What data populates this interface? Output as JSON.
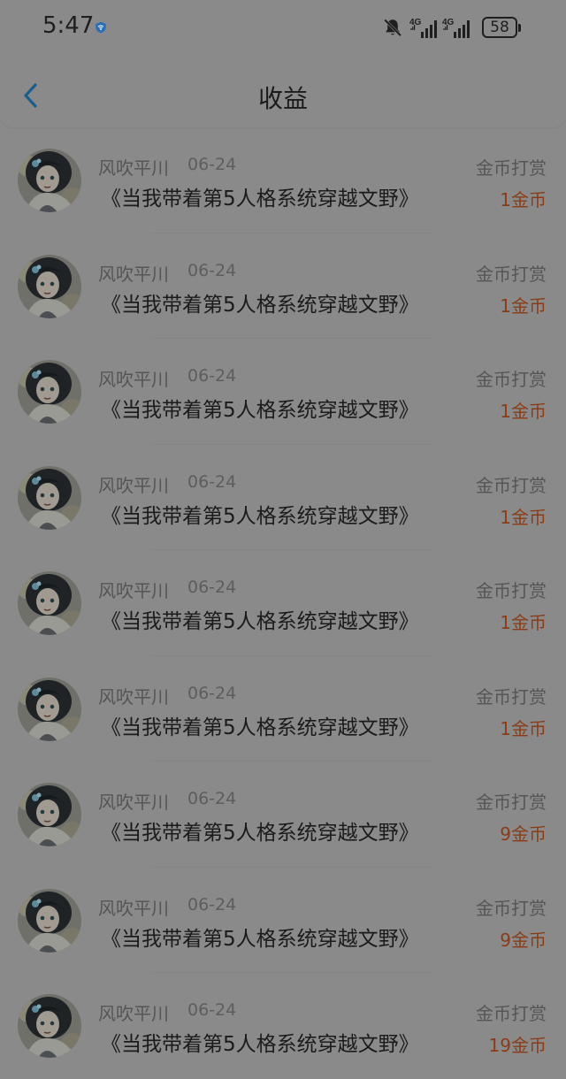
{
  "status_bar": {
    "time": "5:47",
    "network_1": "4G",
    "network_2": "4G",
    "battery_level": "58",
    "icons": [
      "vpn-shield-icon",
      "bell-off-icon",
      "signal-icon",
      "signal-icon",
      "battery-icon"
    ]
  },
  "header": {
    "back_icon": "chevron-left-icon",
    "title": "收益"
  },
  "colors": {
    "background": "#8a8a8a",
    "title_text": "#1b1b1b",
    "secondary_text": "#555555",
    "amount_accent": "#8a3c16",
    "back_icon": "#1d5d8a"
  },
  "list": {
    "items": [
      {
        "name": "风吹平川",
        "date": "06-24",
        "title": "《当我带着第5人格系统穿越文野》",
        "type": "金币打赏",
        "amount": "1金币"
      },
      {
        "name": "风吹平川",
        "date": "06-24",
        "title": "《当我带着第5人格系统穿越文野》",
        "type": "金币打赏",
        "amount": "1金币"
      },
      {
        "name": "风吹平川",
        "date": "06-24",
        "title": "《当我带着第5人格系统穿越文野》",
        "type": "金币打赏",
        "amount": "1金币"
      },
      {
        "name": "风吹平川",
        "date": "06-24",
        "title": "《当我带着第5人格系统穿越文野》",
        "type": "金币打赏",
        "amount": "1金币"
      },
      {
        "name": "风吹平川",
        "date": "06-24",
        "title": "《当我带着第5人格系统穿越文野》",
        "type": "金币打赏",
        "amount": "1金币"
      },
      {
        "name": "风吹平川",
        "date": "06-24",
        "title": "《当我带着第5人格系统穿越文野》",
        "type": "金币打赏",
        "amount": "1金币"
      },
      {
        "name": "风吹平川",
        "date": "06-24",
        "title": "《当我带着第5人格系统穿越文野》",
        "type": "金币打赏",
        "amount": "9金币"
      },
      {
        "name": "风吹平川",
        "date": "06-24",
        "title": "《当我带着第5人格系统穿越文野》",
        "type": "金币打赏",
        "amount": "9金币"
      },
      {
        "name": "风吹平川",
        "date": "06-24",
        "title": "《当我带着第5人格系统穿越文野》",
        "type": "金币打赏",
        "amount": "19金币"
      }
    ]
  }
}
